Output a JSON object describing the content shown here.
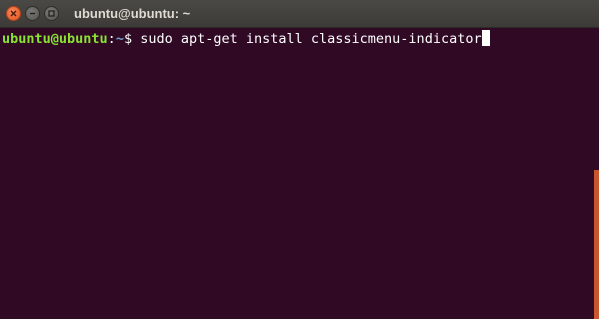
{
  "window": {
    "title": "ubuntu@ubuntu: ~",
    "controls": [
      "close-icon",
      "minimize-icon",
      "maximize-icon"
    ]
  },
  "terminal": {
    "prompt_user_host": "ubuntu@ubuntu",
    "prompt_separator": ":",
    "prompt_path": "~",
    "prompt_symbol": "$ ",
    "command": "sudo apt-get install classicmenu-indicator"
  },
  "colors": {
    "background": "#300a24",
    "prompt_user": "#8ae234",
    "prompt_path": "#729fcf",
    "close_button": "#e0541f",
    "scrollbar": "#c8562e"
  }
}
